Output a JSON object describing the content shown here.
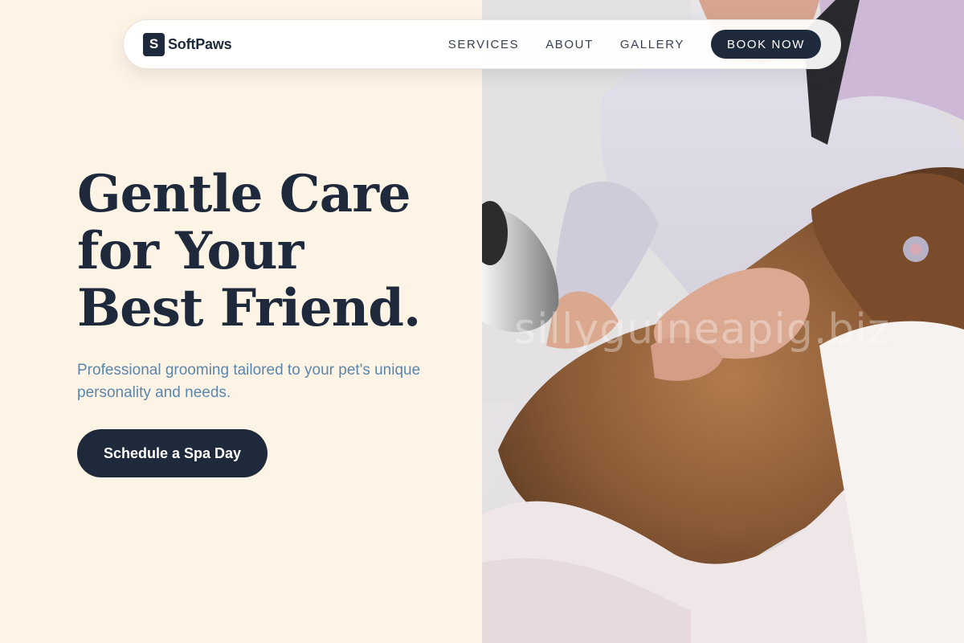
{
  "brand": {
    "mark": "S",
    "name": "SoftPaws"
  },
  "nav": {
    "links": [
      "SERVICES",
      "ABOUT",
      "GALLERY"
    ],
    "cta": "BOOK NOW"
  },
  "hero": {
    "title_lines": [
      "Gentle Care",
      "for Your",
      "Best Friend."
    ],
    "subtitle": "Professional grooming tailored to your pet's unique personality and needs.",
    "cta": "Schedule a Spa Day",
    "watermark": "sillyguineapig.biz"
  },
  "colors": {
    "background": "#fef4e6",
    "navy": "#1e293b",
    "subtitle": "#5a86ad"
  },
  "icons": {
    "brand_mark": "letter-s-logo"
  }
}
